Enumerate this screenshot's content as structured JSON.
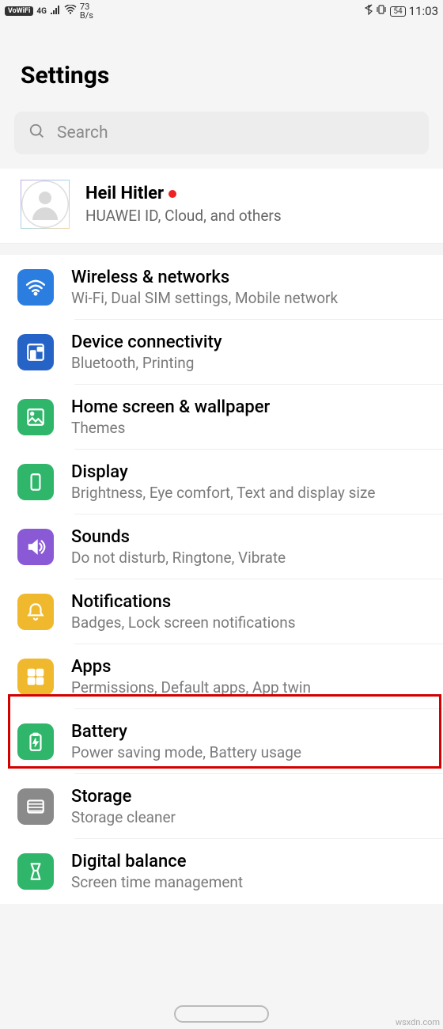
{
  "status": {
    "vowifi": "VoWiFi",
    "network": "4G",
    "speed_top": "73",
    "speed_bottom": "B/s",
    "battery": "54",
    "time": "11:03"
  },
  "title": "Settings",
  "search": {
    "placeholder": "Search"
  },
  "account": {
    "name": "Heil Hitler",
    "subtitle": "HUAWEI ID, Cloud, and others"
  },
  "items": [
    {
      "color": "c-blue",
      "icon": "wifi",
      "title": "Wireless & networks",
      "sub": "Wi-Fi, Dual SIM settings, Mobile network"
    },
    {
      "color": "c-blue2",
      "icon": "connect",
      "title": "Device connectivity",
      "sub": "Bluetooth, Printing"
    },
    {
      "color": "c-green",
      "icon": "image",
      "title": "Home screen & wallpaper",
      "sub": "Themes"
    },
    {
      "color": "c-green",
      "icon": "display",
      "title": "Display",
      "sub": "Brightness, Eye comfort, Text and display size"
    },
    {
      "color": "c-purple",
      "icon": "sound",
      "title": "Sounds",
      "sub": "Do not disturb, Ringtone, Vibrate"
    },
    {
      "color": "c-amber",
      "icon": "bell",
      "title": "Notifications",
      "sub": "Badges, Lock screen notifications"
    },
    {
      "color": "c-amber2",
      "icon": "apps",
      "title": "Apps",
      "sub": "Permissions, Default apps, App twin"
    },
    {
      "color": "c-green",
      "icon": "battery",
      "title": "Battery",
      "sub": "Power saving mode, Battery usage"
    },
    {
      "color": "c-gray",
      "icon": "storage",
      "title": "Storage",
      "sub": "Storage cleaner"
    },
    {
      "color": "c-green",
      "icon": "balance",
      "title": "Digital balance",
      "sub": "Screen time management"
    }
  ],
  "watermark": "wsxdn.com"
}
